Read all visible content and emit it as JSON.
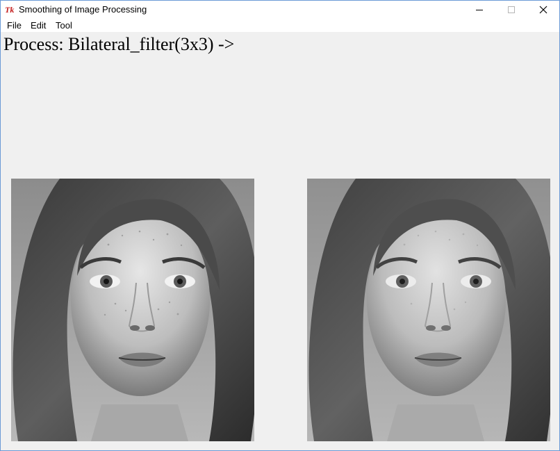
{
  "window": {
    "title": "Smoothing of Image Processing",
    "app_icon": "tk-feather-icon"
  },
  "menu": {
    "items": [
      {
        "label": "File"
      },
      {
        "label": "Edit"
      },
      {
        "label": "Tool"
      }
    ]
  },
  "main": {
    "process_label": "Process: Bilateral_filter(3x3) ->",
    "images": [
      {
        "name": "original-image",
        "content": "grayscale portrait of a woman with freckles and long wavy hair"
      },
      {
        "name": "filtered-image",
        "content": "smoothed grayscale portrait of a woman with freckles and long wavy hair"
      }
    ]
  }
}
